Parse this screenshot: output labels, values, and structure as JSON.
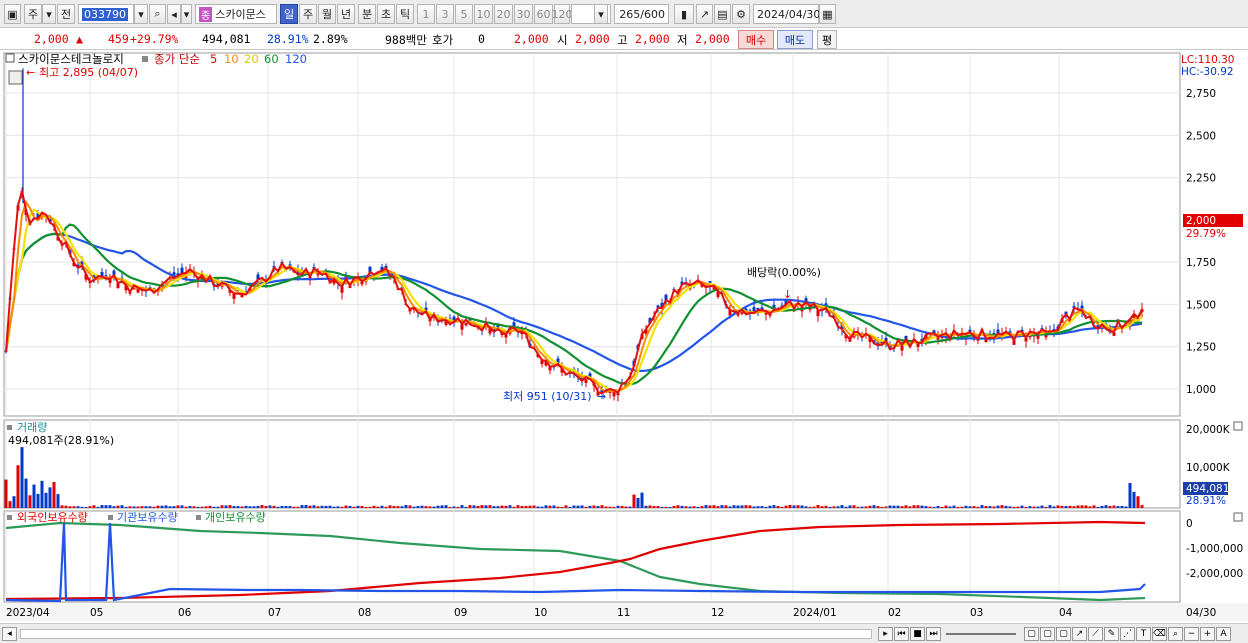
{
  "toolbar": {
    "market": "주",
    "prev": "전",
    "code": "033790",
    "stock_tag": "종",
    "stock_name": "스카이문스",
    "periods": [
      "일",
      "주",
      "월",
      "년",
      "분",
      "초",
      "틱"
    ],
    "active_period": "일",
    "intervals": [
      "1",
      "3",
      "5",
      "10",
      "20",
      "30",
      "60",
      "120"
    ],
    "count": "265",
    "count_total": "/600",
    "date": "2024/04/30"
  },
  "info": {
    "price": "2,000",
    "change": "459",
    "change_pct": "+29.79%",
    "volume": "494,081",
    "turnover_pct": "28.91%",
    "ratio": "2.89%",
    "amount": "988백만",
    "hoga_label": "호가",
    "hoga_value": "0",
    "hoga_price": "2,000",
    "open_label": "시",
    "open": "2,000",
    "high_label": "고",
    "high": "2,000",
    "low_label": "저",
    "low": "2,000",
    "buy": "매수",
    "sell": "매도",
    "avg": "평"
  },
  "price_panel": {
    "title": "스카이문스테크놀로지",
    "ma_label": "종가 단순",
    "ma_periods": [
      "5",
      "10",
      "20",
      "60",
      "120"
    ],
    "ma_colors": [
      "#e01010",
      "#ff8a00",
      "#f2e200",
      "#109030",
      "#2255e8"
    ],
    "high_marker": "최고 2,895 (04/07)",
    "low_marker": "최저 951 (10/31)",
    "event_label": "배당락(0.00%)",
    "lc": "LC:110.30",
    "hc": "HC:-30.92",
    "y_ticks": [
      "2,750",
      "2,500",
      "2,250",
      "1,750",
      "1,500",
      "1,250",
      "1,000"
    ],
    "last_price": "2,000",
    "last_pct": "29.79%"
  },
  "volume_panel": {
    "title": "거래량",
    "current": "494,081주(28.91%)",
    "y_ticks": [
      "20,000K",
      "10,000K"
    ],
    "last_volume": "494,081",
    "last_pct": "28.91%"
  },
  "holdings_panel": {
    "legend": [
      "외국인보유수량",
      "기관보유수량",
      "개인보유수량"
    ],
    "y_ticks": [
      "0",
      "-1,000,000",
      "-2,000,000"
    ]
  },
  "x_axis": [
    "2023/04",
    "05",
    "06",
    "07",
    "08",
    "09",
    "10",
    "11",
    "12",
    "2024/01",
    "02",
    "03",
    "04",
    "04/30"
  ],
  "colors": {
    "up": "#e00000",
    "down": "#0038c8",
    "last_price_box": "#e00000"
  }
}
